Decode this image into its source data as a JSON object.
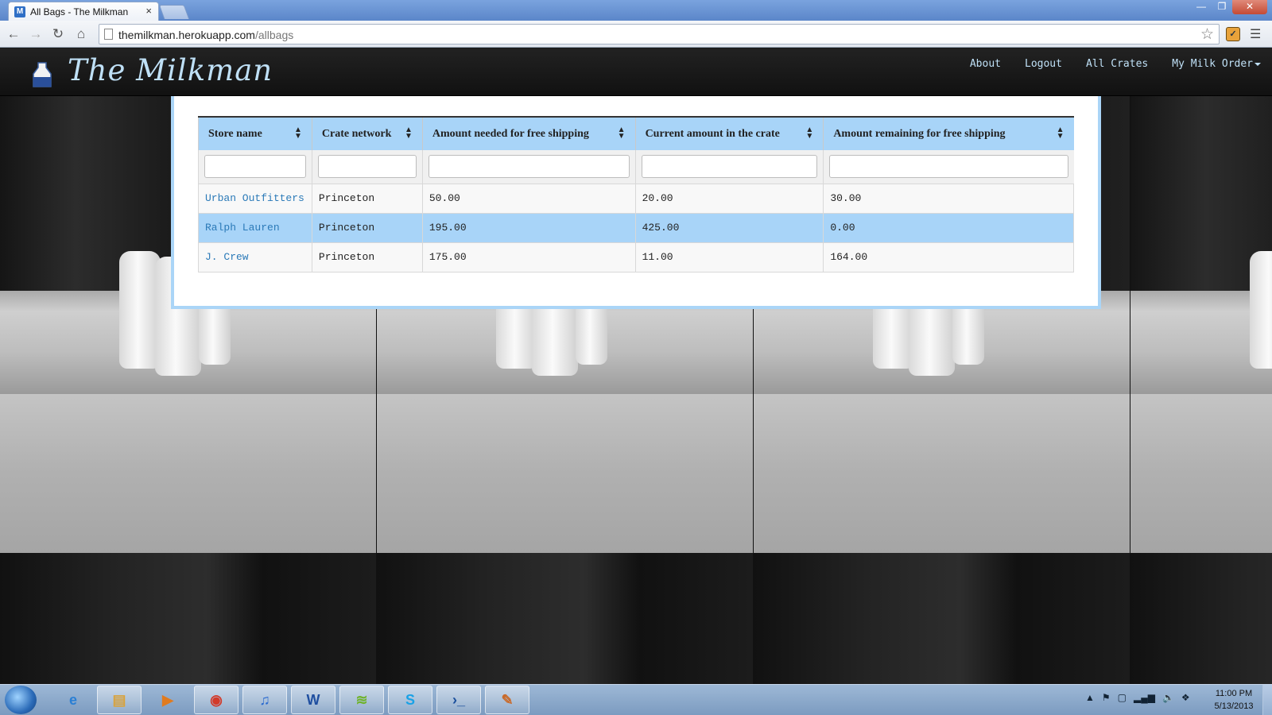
{
  "browser": {
    "tab_title": "All Bags - The Milkman",
    "tab_favicon": "M",
    "tab_close": "×",
    "url_host": "themilkman.herokuapp.com",
    "url_path": "/allbags",
    "window_controls": [
      "—",
      "❐",
      "✕"
    ]
  },
  "site": {
    "brand": "The Milkman",
    "nav": [
      {
        "label": "About"
      },
      {
        "label": "Logout"
      },
      {
        "label": "All Crates"
      },
      {
        "label": "My Milk Order"
      }
    ]
  },
  "table": {
    "columns": [
      {
        "label": "Store name"
      },
      {
        "label": "Crate network"
      },
      {
        "label": "Amount needed for free shipping"
      },
      {
        "label": "Current amount in the crate"
      },
      {
        "label": "Amount remaining for free shipping"
      }
    ],
    "rows": [
      {
        "store": "Urban Outfitters",
        "network": "Princeton",
        "needed": "50.00",
        "current": "20.00",
        "remaining": "30.00"
      },
      {
        "store": "Ralph Lauren",
        "network": "Princeton",
        "needed": "195.00",
        "current": "425.00",
        "remaining": "0.00"
      },
      {
        "store": "J. Crew",
        "network": "Princeton",
        "needed": "175.00",
        "current": "11.00",
        "remaining": "164.00"
      }
    ]
  },
  "taskbar": {
    "apps": [
      {
        "name": "internet-explorer-icon",
        "glyph": "e",
        "color": "#2a7fd4"
      },
      {
        "name": "file-explorer-icon",
        "glyph": "▤",
        "color": "#d9a23a"
      },
      {
        "name": "media-player-icon",
        "glyph": "▶",
        "color": "#e07b1f"
      },
      {
        "name": "chrome-icon",
        "glyph": "◉",
        "color": "#d23a2a"
      },
      {
        "name": "itunes-icon",
        "glyph": "♫",
        "color": "#2b6bd0"
      },
      {
        "name": "word-icon",
        "glyph": "W",
        "color": "#1f4fa0"
      },
      {
        "name": "spotify-icon",
        "glyph": "≋",
        "color": "#6fb32b"
      },
      {
        "name": "skype-icon",
        "glyph": "S",
        "color": "#1aa2e6"
      },
      {
        "name": "powershell-icon",
        "glyph": "›_",
        "color": "#1a4f9c"
      },
      {
        "name": "paint-icon",
        "glyph": "✎",
        "color": "#c96a2a"
      }
    ],
    "clock_time": "11:00 PM",
    "clock_date": "5/13/2013"
  }
}
